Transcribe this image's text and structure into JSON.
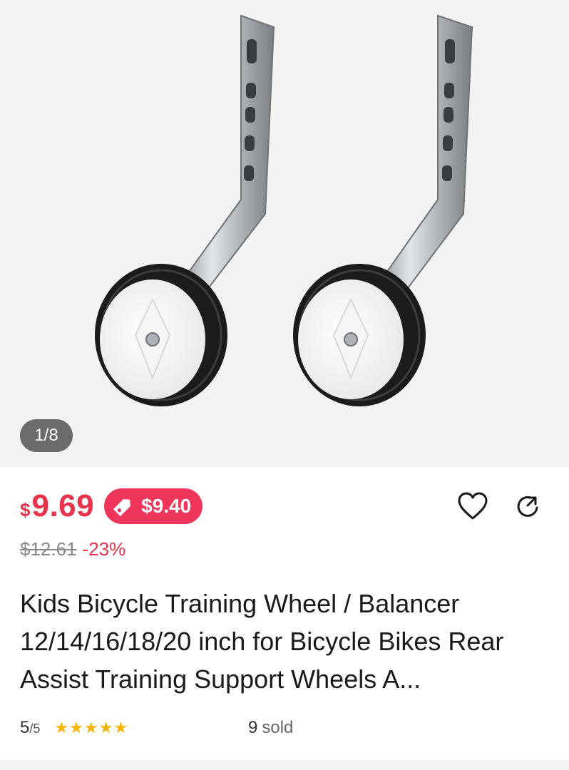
{
  "gallery": {
    "counter": "1/8"
  },
  "product": {
    "currency": "$",
    "price": "9.69",
    "coupon_price": "$9.40",
    "original_price": "$12.61",
    "discount": "-23%",
    "title": "Kids Bicycle Training Wheel / Balancer 12/14/16/18/20 inch for Bicycle Bikes Rear Assist Training Support Wheels A...",
    "rating": "5",
    "rating_max": "/5",
    "stars": 5,
    "sold_count": "9",
    "sold_label": "sold"
  },
  "colors": {
    "accent": "#e8334d",
    "coupon_bg": "#f0355a",
    "star": "#f5b400"
  },
  "icons": [
    "coupon-tag-icon",
    "heart-icon",
    "share-icon",
    "star-icon"
  ]
}
